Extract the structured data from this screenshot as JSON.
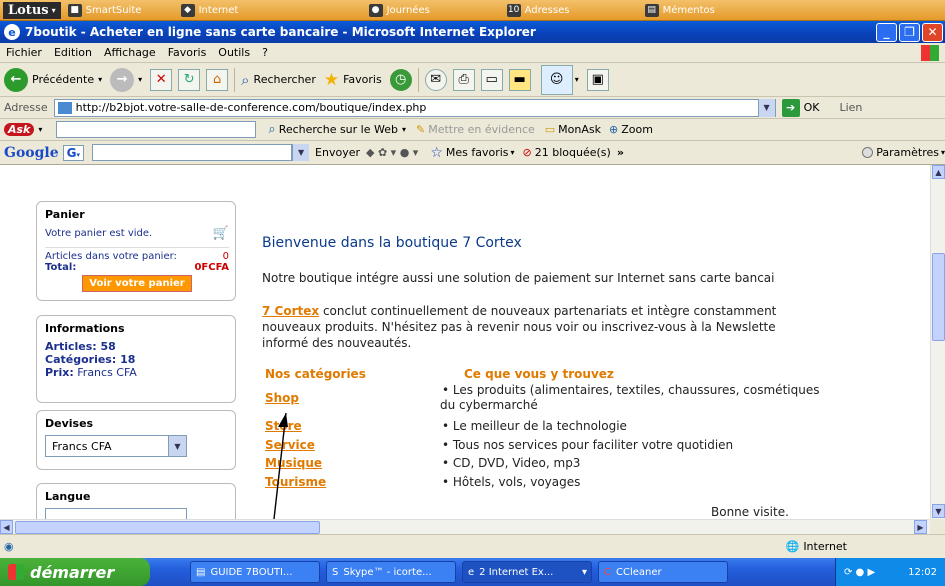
{
  "lotus_bar": {
    "logo": "Lotus",
    "segments": [
      "SmartSuite",
      "Internet",
      "Journées",
      "Adresses",
      "Mémentos"
    ],
    "day_number": "10"
  },
  "window": {
    "title": "7boutik - Acheter en ligne sans carte bancaire - Microsoft Internet Explorer"
  },
  "menu": [
    "Fichier",
    "Edition",
    "Affichage",
    "Favoris",
    "Outils",
    "?"
  ],
  "toolbar": {
    "back": "Précédente",
    "search": "Rechercher",
    "favorites": "Favoris"
  },
  "address": {
    "label": "Adresse",
    "url": "http://b2bjot.votre-salle-de-conference.com/boutique/index.php",
    "go": "OK",
    "links": "Lien"
  },
  "ask_bar": {
    "logo": "Ask",
    "search_web": "Recherche sur le Web",
    "highlight": "Mettre en évidence",
    "monask": "MonAsk",
    "zoom": "Zoom"
  },
  "google_bar": {
    "logo": "Google",
    "send": "Envoyer",
    "my_favorites": "Mes favoris",
    "blocked": "21 bloquée(s)",
    "settings": "Paramètres"
  },
  "sidebar": {
    "cart": {
      "title": "Panier",
      "empty": "Votre panier est vide.",
      "articles_label": "Articles dans votre panier:",
      "articles_count": "0",
      "total_label": "Total:",
      "total_value": "0FCFA",
      "button": "Voir votre panier"
    },
    "info": {
      "title": "Informations",
      "articles": "Articles: 58",
      "categories": "Catégories: 18",
      "price_label": "Prix:",
      "price_value": "Francs CFA"
    },
    "currency": {
      "title": "Devises",
      "selected": "Francs CFA"
    },
    "language": {
      "title": "Langue"
    }
  },
  "main": {
    "welcome": "Bienvenue dans la boutique 7 Cortex",
    "intro": "Notre boutique intégre aussi une solution de paiement sur Internet sans carte bancai",
    "para_link": "7 Cortex",
    "para_line1": " conclut continuellement de nouveaux partenariats et intègre constamment",
    "para_line2": "nouveaux produits. N'hésitez pas à revenir nous voir ou inscrivez-vous à la Newslette",
    "para_line3": "informé des nouveautés.",
    "col_categories": "Nos catégories",
    "col_find": "Ce que vous y trouvez",
    "categories": [
      {
        "name": "Shop",
        "desc": "• Les produits (alimentaires, textiles, chaussures, cosmétiques",
        "desc2": "du cybermarché"
      },
      {
        "name": "Store",
        "desc": "• Le meilleur de la technologie"
      },
      {
        "name": "Service",
        "desc": "• Tous nos services pour faciliter votre quotidien"
      },
      {
        "name": "Musique",
        "desc": "• CD, DVD, Video, mp3"
      },
      {
        "name": "Tourisme",
        "desc": "•  Hôtels, vols, voyages"
      }
    ],
    "closing": "Bonne visite."
  },
  "status": {
    "zone": "Internet"
  },
  "taskbar": {
    "start": "démarrer",
    "tasks": [
      "GUIDE 7BOUTI...",
      "Skype™ - icorte...",
      "2 Internet Ex...",
      "CCleaner"
    ],
    "clock": "12:02"
  }
}
